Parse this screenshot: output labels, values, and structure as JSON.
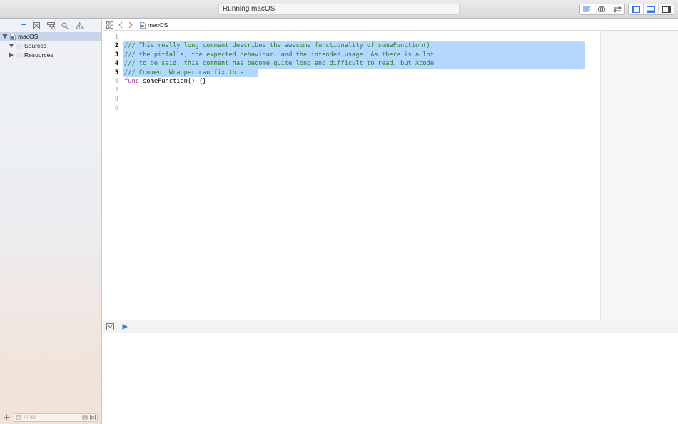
{
  "toolbar": {
    "activity_text": "Running macOS",
    "editor_mode_buttons": [
      "standard-editor",
      "assistant-editor",
      "version-editor"
    ],
    "view_buttons": [
      "navigator-toggle",
      "debug-area-toggle",
      "utilities-toggle"
    ]
  },
  "navigator": {
    "tabs": [
      "project-navigator",
      "source-control-navigator",
      "symbol-navigator",
      "find-navigator",
      "issue-navigator"
    ],
    "tree": [
      {
        "label": "macOS",
        "type": "project",
        "expanded": true,
        "selected": true,
        "depth": 0
      },
      {
        "label": "Sources",
        "type": "folder",
        "expanded": true,
        "selected": false,
        "depth": 1
      },
      {
        "label": "Resources",
        "type": "folder",
        "expanded": false,
        "selected": false,
        "depth": 1
      }
    ],
    "filter_placeholder": "Filter"
  },
  "jumpbar": {
    "breadcrumb": "macOS"
  },
  "editor": {
    "lines": [
      {
        "num": "1",
        "text": "",
        "kind": "plain",
        "selected": false
      },
      {
        "num": "2",
        "text": "/// This really long comment describes the awesome functionality of someFunction(),",
        "kind": "comment",
        "selected": true
      },
      {
        "num": "3",
        "text": "/// the pitfalls, the expected behaviour, and the intended usage. As there is a lot",
        "kind": "comment",
        "selected": true
      },
      {
        "num": "4",
        "text": "/// to be said, this comment has become quite long and difficult to read, but Xcode",
        "kind": "comment",
        "selected": true
      },
      {
        "num": "5",
        "text": "/// Comment Wrapper can fix this.",
        "kind": "comment",
        "selected": true
      },
      {
        "num": "6",
        "keyword": "func",
        "text": " someFunction() {}",
        "kind": "code",
        "selected": false
      },
      {
        "num": "7",
        "text": "",
        "kind": "plain",
        "selected": false
      },
      {
        "num": "8",
        "text": "",
        "kind": "plain",
        "selected": false
      },
      {
        "num": "9",
        "text": "",
        "kind": "plain",
        "selected": false
      }
    ]
  },
  "colors": {
    "comment": "#2a7d24",
    "keyword": "#ad3da4",
    "selection": "#b3d7ff",
    "accent": "#2f7ee6"
  }
}
